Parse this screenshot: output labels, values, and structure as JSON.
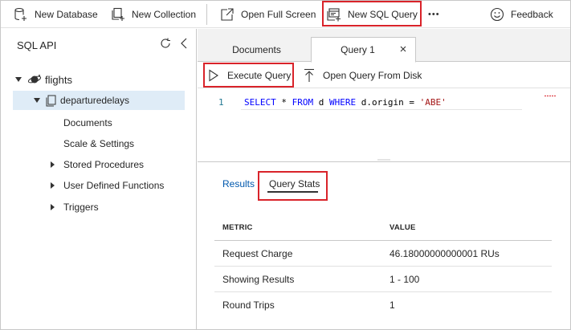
{
  "toolbar": {
    "new_database": "New Database",
    "new_collection": "New Collection",
    "open_full_screen": "Open Full Screen",
    "new_sql_query": "New SQL Query",
    "more": "•••",
    "feedback": "Feedback"
  },
  "sidebar": {
    "title": "SQL API",
    "database": "flights",
    "collection": "departuredelays",
    "items": [
      {
        "label": "Documents"
      },
      {
        "label": "Scale & Settings"
      },
      {
        "label": "Stored Procedures"
      },
      {
        "label": "User Defined Functions"
      },
      {
        "label": "Triggers"
      }
    ]
  },
  "tabs": [
    {
      "label": "Documents"
    },
    {
      "label": "Query 1"
    }
  ],
  "commands": {
    "execute_query": "Execute Query",
    "open_query_from_disk": "Open Query From Disk"
  },
  "editor": {
    "line_number": "1",
    "tokens": {
      "t1": "SELECT",
      "t2": " * ",
      "t3": "FROM",
      "t4": " d ",
      "t5": "WHERE",
      "t6": " d.origin = ",
      "t7": "'ABE'"
    }
  },
  "results": {
    "tab_results": "Results",
    "tab_query_stats": "Query Stats",
    "header": {
      "metric": "METRIC",
      "value": "VALUE"
    },
    "rows": [
      {
        "metric": "Request Charge",
        "value": "46.18000000000001 RUs"
      },
      {
        "metric": "Showing Results",
        "value": "1 - 100"
      },
      {
        "metric": "Round Trips",
        "value": "1"
      }
    ]
  },
  "colors": {
    "highlight": "#d9232a",
    "selected_row": "#dfecf7",
    "link": "#0058ad",
    "keyword": "#0000ff",
    "string": "#a31515"
  }
}
